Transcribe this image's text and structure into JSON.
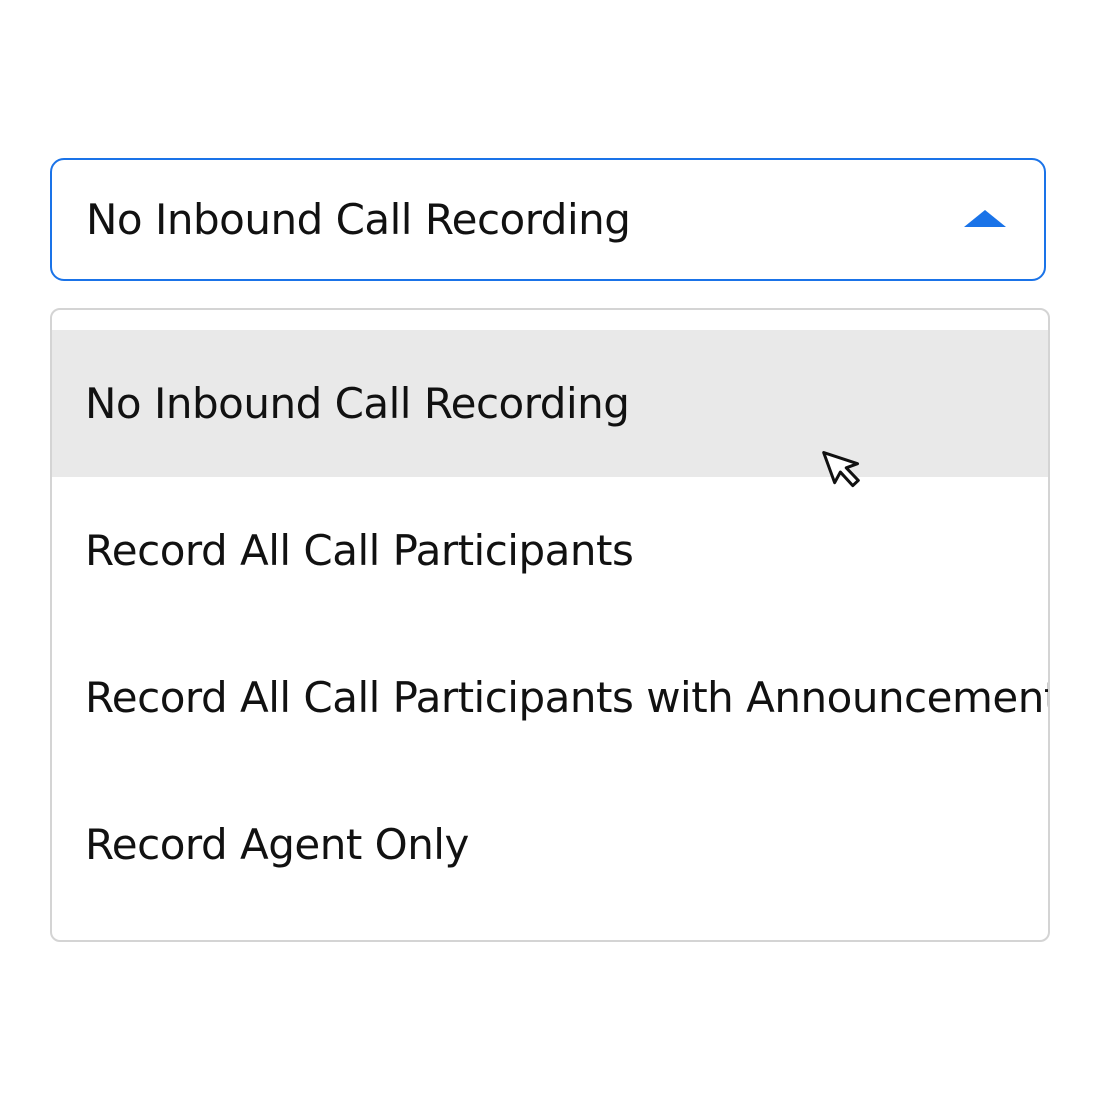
{
  "select": {
    "value": "No Inbound Call Recording",
    "expanded": true,
    "caret_icon": "caret-up-icon",
    "accent_color": "#1a73e8"
  },
  "options": [
    {
      "label": "No Inbound Call Recording",
      "highlighted": true
    },
    {
      "label": "Record All Call Participants",
      "highlighted": false
    },
    {
      "label": "Record All Call Participants with Announcement",
      "highlighted": false
    },
    {
      "label": "Record Agent Only",
      "highlighted": false
    }
  ],
  "highlight_color": "#e9e9e9",
  "pointer": {
    "icon": "mouse-pointer-icon"
  }
}
